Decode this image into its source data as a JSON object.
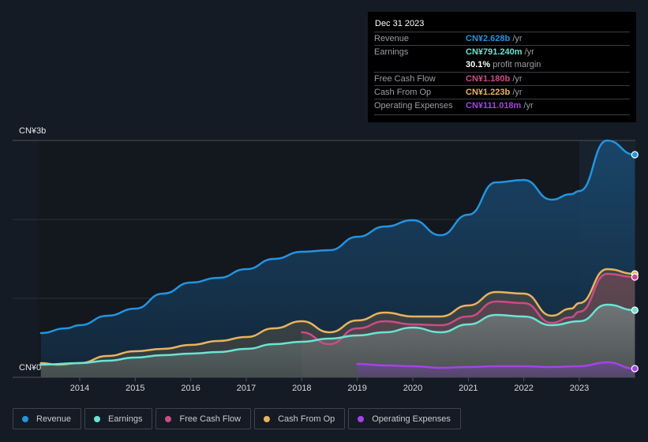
{
  "tooltip": {
    "date": "Dec 31 2023",
    "rows": [
      {
        "label": "Revenue",
        "value": "CN¥2.628b",
        "unit": " /yr",
        "color": "#2394df"
      },
      {
        "label": "Earnings",
        "value": "CN¥791.240m",
        "unit": " /yr",
        "color": "#6ae4d2"
      },
      {
        "label": "",
        "value": "30.1%",
        "unit": " profit margin",
        "color": "#ffffff"
      },
      {
        "label": "Free Cash Flow",
        "value": "CN¥1.180b",
        "unit": " /yr",
        "color": "#cc4b86"
      },
      {
        "label": "Cash From Op",
        "value": "CN¥1.223b",
        "unit": " /yr",
        "color": "#e8b35f"
      },
      {
        "label": "Operating Expenses",
        "value": "CN¥111.018m",
        "unit": " /yr",
        "color": "#a443e8"
      }
    ]
  },
  "legend": [
    {
      "label": "Revenue",
      "color": "#2394df"
    },
    {
      "label": "Earnings",
      "color": "#6ae4d2"
    },
    {
      "label": "Free Cash Flow",
      "color": "#cc4b86"
    },
    {
      "label": "Cash From Op",
      "color": "#e8b35f"
    },
    {
      "label": "Operating Expenses",
      "color": "#a443e8"
    }
  ],
  "chart_data": {
    "type": "area",
    "title": "",
    "xlabel": "",
    "ylabel": "",
    "y_unit": "CN¥ billions",
    "ylim": [
      0,
      3
    ],
    "ytick_labels": [
      "CN¥0",
      "CN¥3b"
    ],
    "xlim": [
      2013.3,
      2024.0
    ],
    "xtick_labels": [
      "2014",
      "2015",
      "2016",
      "2017",
      "2018",
      "2019",
      "2020",
      "2021",
      "2022",
      "2023"
    ],
    "highlight_from": 2023.0,
    "series": [
      {
        "name": "Revenue",
        "color": "#2394df",
        "x": [
          2013.3,
          2013.75,
          2014.0,
          2014.5,
          2015.0,
          2015.5,
          2016.0,
          2016.5,
          2017.0,
          2017.5,
          2018.0,
          2018.5,
          2019.0,
          2019.5,
          2020.0,
          2020.5,
          2021.0,
          2021.5,
          2022.0,
          2022.5,
          2022.85,
          2023.0,
          2023.5,
          2024.0
        ],
        "y": [
          0.56,
          0.62,
          0.66,
          0.78,
          0.87,
          1.06,
          1.2,
          1.26,
          1.37,
          1.5,
          1.59,
          1.61,
          1.78,
          1.91,
          1.99,
          1.8,
          2.06,
          2.47,
          2.5,
          2.25,
          2.32,
          2.36,
          3.0,
          2.82
        ]
      },
      {
        "name": "Earnings",
        "color": "#6ae4d2",
        "x": [
          2013.3,
          2014.0,
          2014.5,
          2015.0,
          2015.5,
          2016.0,
          2016.5,
          2017.0,
          2017.5,
          2018.0,
          2018.5,
          2019.0,
          2019.5,
          2020.0,
          2020.5,
          2021.0,
          2021.5,
          2022.0,
          2022.5,
          2023.0,
          2023.5,
          2024.0
        ],
        "y": [
          0.16,
          0.18,
          0.21,
          0.25,
          0.28,
          0.3,
          0.32,
          0.36,
          0.42,
          0.45,
          0.49,
          0.53,
          0.57,
          0.63,
          0.57,
          0.67,
          0.79,
          0.77,
          0.66,
          0.71,
          0.92,
          0.85
        ]
      },
      {
        "name": "Free Cash Flow",
        "color": "#cc4b86",
        "x": [
          2018.0,
          2018.5,
          2019.0,
          2019.5,
          2020.0,
          2020.5,
          2021.0,
          2021.5,
          2022.0,
          2022.5,
          2022.85,
          2023.0,
          2023.5,
          2024.0
        ],
        "y": [
          0.57,
          0.42,
          0.62,
          0.71,
          0.67,
          0.66,
          0.77,
          0.96,
          0.94,
          0.69,
          0.76,
          0.83,
          1.31,
          1.27
        ]
      },
      {
        "name": "Cash From Op",
        "color": "#e8b35f",
        "x": [
          2013.3,
          2013.6,
          2014.0,
          2014.5,
          2015.0,
          2015.5,
          2016.0,
          2016.5,
          2017.0,
          2017.5,
          2018.0,
          2018.5,
          2019.0,
          2019.5,
          2020.0,
          2020.5,
          2021.0,
          2021.5,
          2022.0,
          2022.5,
          2022.85,
          2023.0,
          2023.5,
          2024.0
        ],
        "y": [
          0.18,
          0.16,
          0.18,
          0.27,
          0.33,
          0.36,
          0.41,
          0.46,
          0.51,
          0.62,
          0.71,
          0.57,
          0.72,
          0.82,
          0.77,
          0.77,
          0.91,
          1.08,
          1.06,
          0.78,
          0.87,
          0.94,
          1.37,
          1.31
        ]
      },
      {
        "name": "Operating Expenses",
        "color": "#a443e8",
        "x": [
          2019.0,
          2019.5,
          2020.0,
          2020.5,
          2021.0,
          2021.5,
          2022.0,
          2022.5,
          2023.0,
          2023.5,
          2024.0
        ],
        "y": [
          0.17,
          0.15,
          0.14,
          0.12,
          0.13,
          0.14,
          0.14,
          0.13,
          0.14,
          0.19,
          0.11
        ]
      }
    ]
  }
}
